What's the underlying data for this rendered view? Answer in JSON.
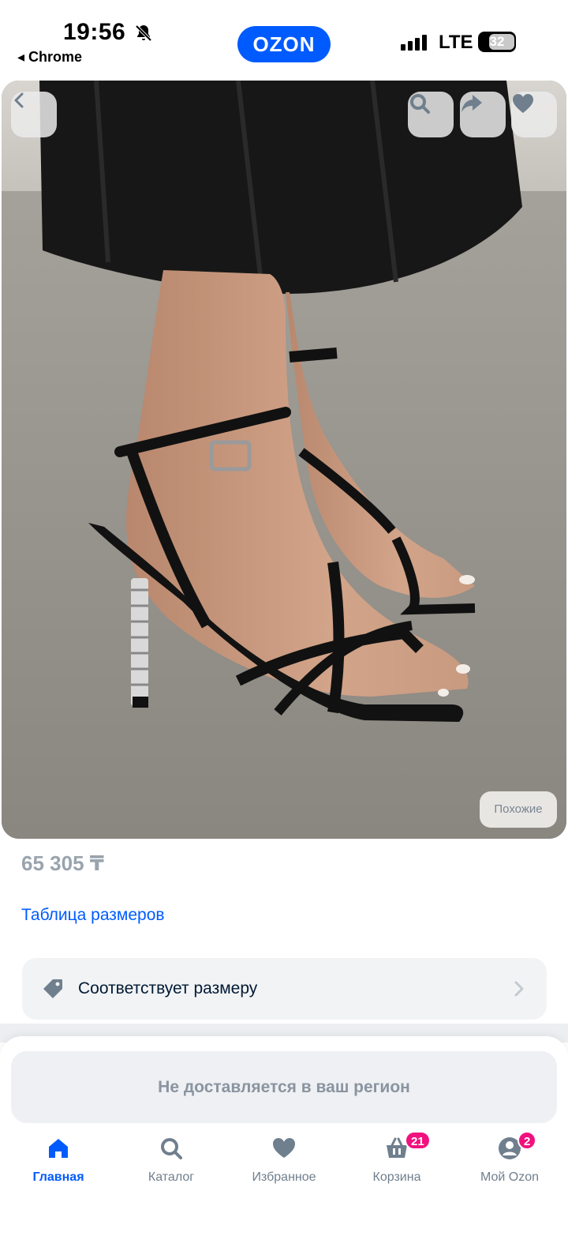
{
  "status_bar": {
    "time": "19:56",
    "back_app": "◂ Chrome",
    "network": "LTE",
    "battery": "32"
  },
  "header": {
    "logo": "OZON"
  },
  "photo_actions": {
    "back": "chevron-left-icon",
    "search": "search-icon",
    "share": "share-icon",
    "favorite": "heart-icon",
    "similar": "Похожие"
  },
  "product": {
    "price": "65 305 ₸",
    "size_table_link": "Таблица размеров",
    "fit_label": "Соответствует размеру"
  },
  "delivery": {
    "notice": "Не доставляется в ваш регион"
  },
  "tabbar": {
    "items": [
      {
        "label": "Главная",
        "icon": "home-icon",
        "active": true
      },
      {
        "label": "Каталог",
        "icon": "search-icon"
      },
      {
        "label": "Избранное",
        "icon": "heart-icon"
      },
      {
        "label": "Корзина",
        "icon": "cart-icon",
        "badge": "21"
      },
      {
        "label": "Мой Ozon",
        "icon": "profile-icon",
        "badge": "2"
      }
    ]
  },
  "colors": {
    "brand": "#005bff",
    "badge": "#f1117e"
  }
}
